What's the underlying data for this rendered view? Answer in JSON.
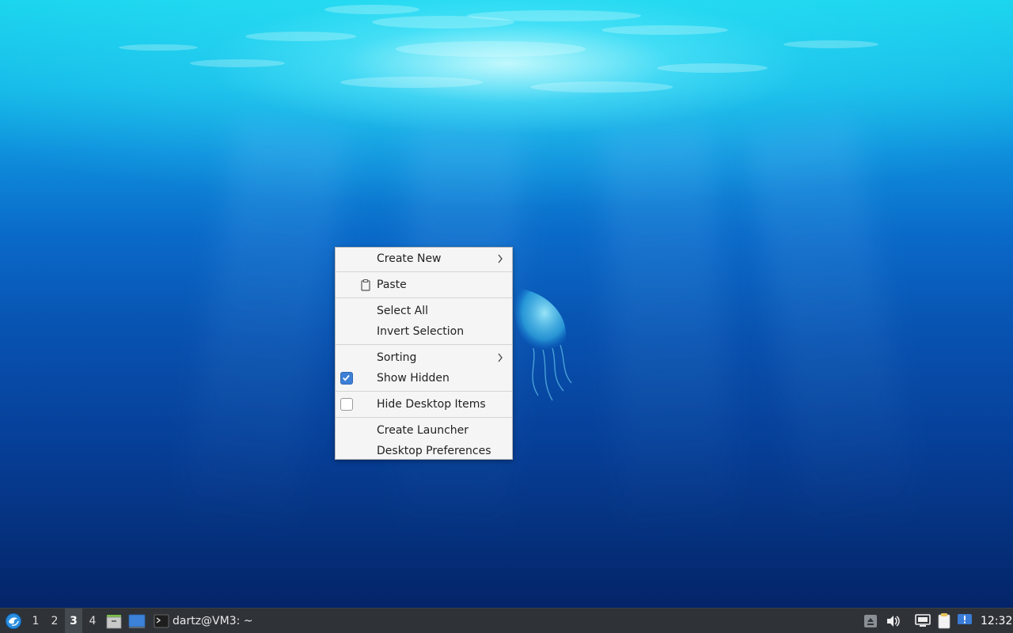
{
  "desktop": {
    "wallpaper": "underwater-jellyfish",
    "accent": "#0a69c8"
  },
  "context_menu": {
    "items": [
      {
        "label": "Create New",
        "submenu": true
      },
      {
        "label": "Paste",
        "icon": "clipboard-icon"
      },
      {
        "label": "Select All"
      },
      {
        "label": "Invert Selection"
      },
      {
        "label": "Sorting",
        "submenu": true
      },
      {
        "label": "Show Hidden",
        "checked": true
      },
      {
        "label": "Hide Desktop Items",
        "checked": false
      },
      {
        "label": "Create Launcher"
      },
      {
        "label": "Desktop Preferences"
      }
    ]
  },
  "taskbar": {
    "start_icon": "lxqt-menu-icon",
    "workspaces": [
      "1",
      "2",
      "3",
      "4"
    ],
    "active_workspace": "3",
    "quicklaunch": [
      "file-manager-icon",
      "show-desktop-icon"
    ],
    "task": {
      "icon": "terminal-icon",
      "title": "dartz@VM3: ~"
    },
    "tray": [
      "eject-icon",
      "volume-icon",
      "network-icon",
      "clipboard-tray-icon",
      "notification-icon"
    ],
    "clock": "12:32",
    "background": "#2f3338",
    "active_ws_bg": "#454a50",
    "check_color": "#3d7fd6"
  }
}
